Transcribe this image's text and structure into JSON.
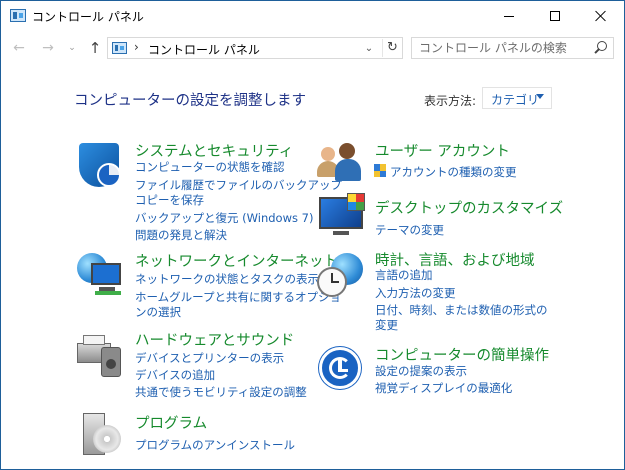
{
  "window": {
    "title": "コントロール パネル",
    "buttons": [
      "minimize",
      "maximize",
      "close"
    ]
  },
  "nav": {
    "back_icon": "←",
    "forward_icon": "→",
    "recent_icon": "⌄",
    "up_icon": "↑",
    "breadcrumb_sep": "›",
    "address": "コントロール パネル",
    "dropdown_icon": "⌄",
    "refresh_icon": "↻",
    "search_placeholder": "コントロール パネルの検索"
  },
  "main": {
    "heading": "コンピューターの設定を調整します",
    "view_by_label": "表示方法:",
    "view_by_value": "カテゴリ"
  },
  "categories": [
    {
      "title": "システムとセキュリティ",
      "icon": "shield-icon",
      "links": [
        "コンピューターの状態を確認",
        "ファイル履歴でファイルのバックアップ",
        "コピーを保存",
        "バックアップと復元 (Windows 7)",
        "問題の発見と解決"
      ]
    },
    {
      "title": "ネットワークとインターネット",
      "icon": "network-globe-icon",
      "links": [
        "ネットワークの状態とタスクの表示",
        "ホームグループと共有に関するオプショ",
        "ンの選択"
      ]
    },
    {
      "title": "ハードウェアとサウンド",
      "icon": "printer-speaker-icon",
      "links": [
        "デバイスとプリンターの表示",
        "デバイスの追加",
        "共通で使うモビリティ設定の調整"
      ]
    },
    {
      "title": "プログラム",
      "icon": "programs-box-icon",
      "links": [
        "プログラムのアンインストール"
      ]
    },
    {
      "title": "ユーザー アカウント",
      "icon": "users-icon",
      "links": [
        "アカウントの種類の変更"
      ]
    },
    {
      "title": "デスクトップのカスタマイズ",
      "icon": "desktop-monitor-icon",
      "links": [
        "テーマの変更"
      ]
    },
    {
      "title": "時計、言語、および地域",
      "icon": "clock-globe-icon",
      "links": [
        "言語の追加",
        "入力方法の変更",
        "日付、時刻、または数値の形式の",
        "変更"
      ]
    },
    {
      "title": "コンピューターの簡単操作",
      "icon": "ease-of-access-icon",
      "links": [
        "設定の提案の表示",
        "視覚ディスプレイの最適化"
      ]
    }
  ],
  "colors": {
    "category_title": "#168a2d",
    "link": "#1e5fb0",
    "heading": "#1e3287",
    "window_border": "#1e5f9a"
  }
}
